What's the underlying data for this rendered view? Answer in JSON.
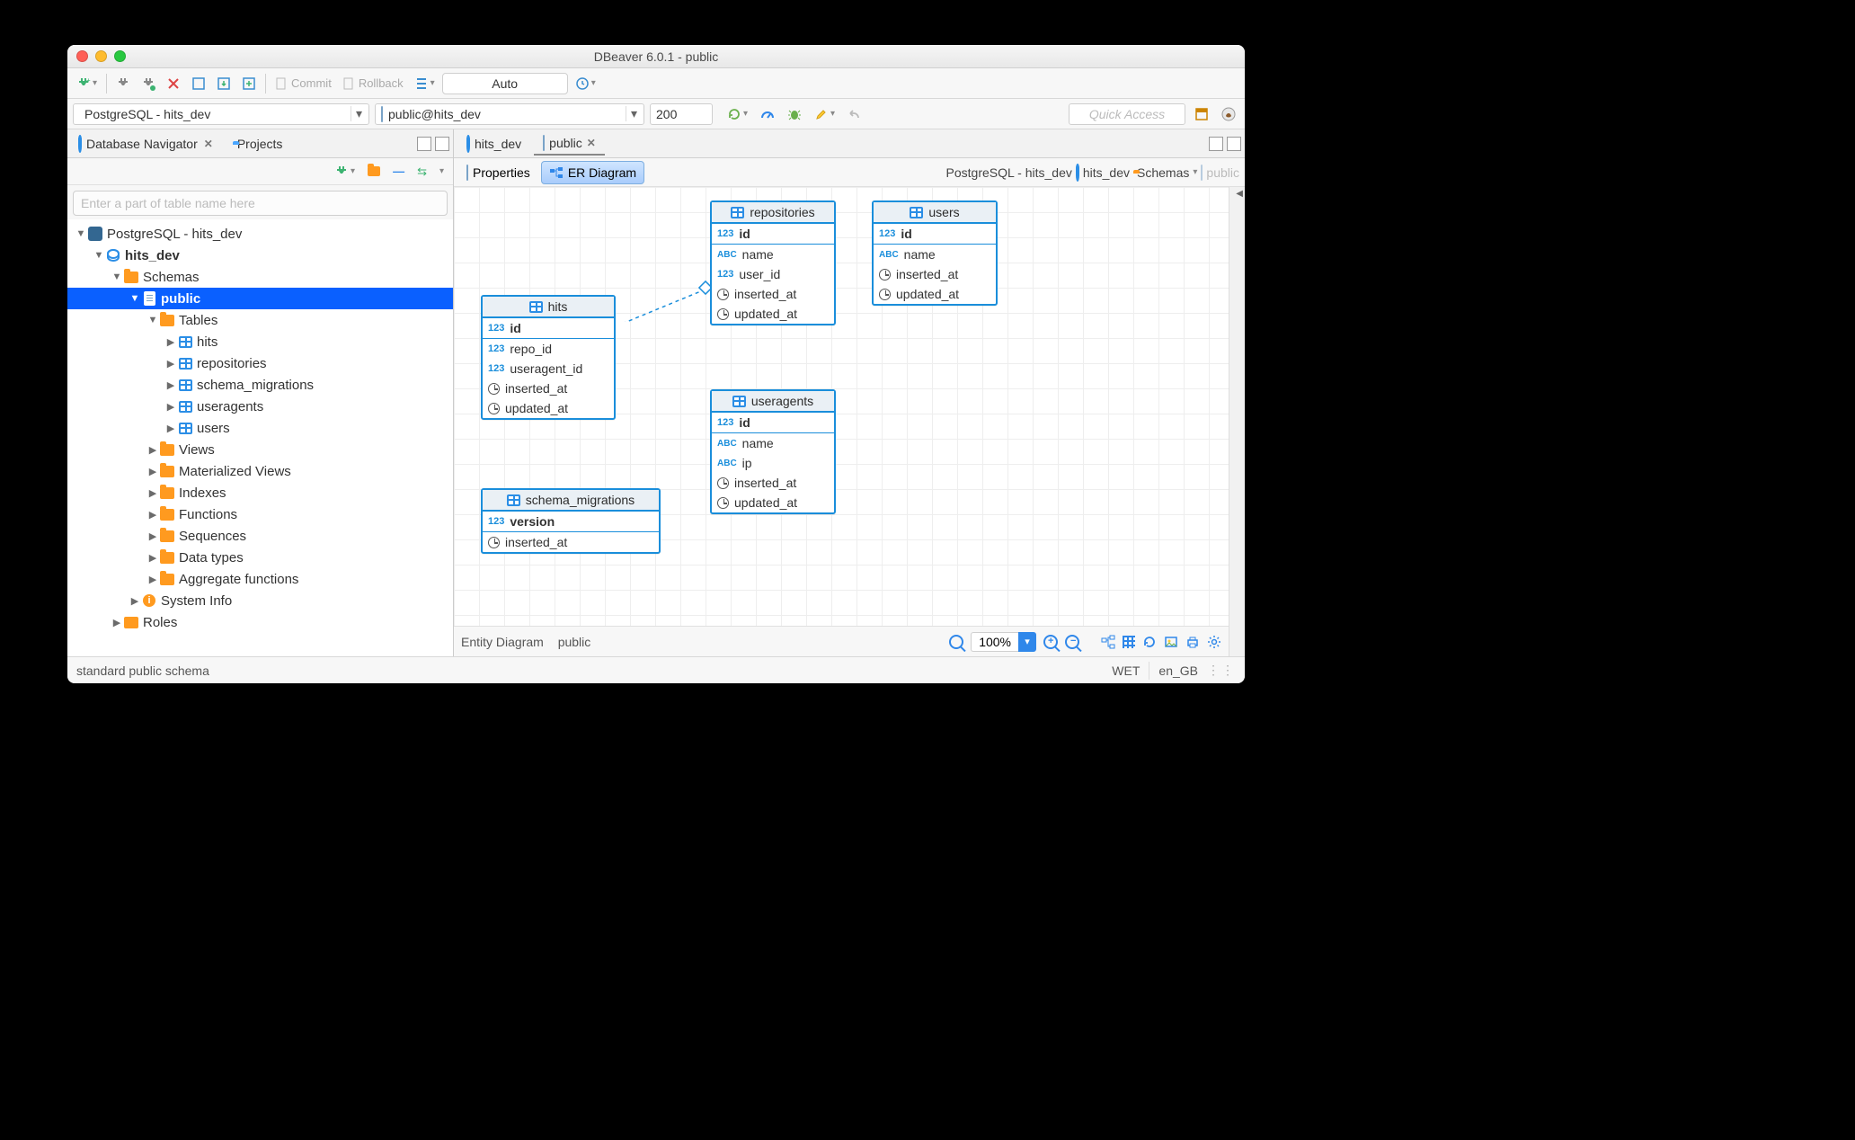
{
  "window": {
    "title": "DBeaver 6.0.1 - public"
  },
  "toolbar": {
    "commit": "Commit",
    "rollback": "Rollback",
    "mode": "Auto"
  },
  "connection_bar": {
    "connection": "PostgreSQL - hits_dev",
    "schema": "public@hits_dev",
    "rows": "200",
    "quick_access": "Quick Access"
  },
  "navigator": {
    "tab1": "Database Navigator",
    "tab2": "Projects",
    "filter_placeholder": "Enter a part of table name here",
    "tree": {
      "conn": "PostgreSQL - hits_dev",
      "db": "hits_dev",
      "schemas": "Schemas",
      "public": "public",
      "tables": "Tables",
      "t0": "hits",
      "t1": "repositories",
      "t2": "schema_migrations",
      "t3": "useragents",
      "t4": "users",
      "views": "Views",
      "mviews": "Materialized Views",
      "indexes": "Indexes",
      "functions": "Functions",
      "sequences": "Sequences",
      "datatypes": "Data types",
      "aggfns": "Aggregate functions",
      "sysinfo": "System Info",
      "roles": "Roles"
    }
  },
  "editor": {
    "tab_hitsdev": "hits_dev",
    "tab_public": "public",
    "subtab_properties": "Properties",
    "subtab_er": "ER Diagram",
    "crumb_conn": "PostgreSQL - hits_dev",
    "crumb_db": "hits_dev",
    "crumb_schemas": "Schemas",
    "crumb_public": "public"
  },
  "diagram": {
    "hits": {
      "name": "hits",
      "cols": [
        "id",
        "repo_id",
        "useragent_id",
        "inserted_at",
        "updated_at"
      ]
    },
    "repositories": {
      "name": "repositories",
      "cols": [
        "id",
        "name",
        "user_id",
        "inserted_at",
        "updated_at"
      ]
    },
    "users": {
      "name": "users",
      "cols": [
        "id",
        "name",
        "inserted_at",
        "updated_at"
      ]
    },
    "useragents": {
      "name": "useragents",
      "cols": [
        "id",
        "name",
        "ip",
        "inserted_at",
        "updated_at"
      ]
    },
    "schema_migrations": {
      "name": "schema_migrations",
      "cols": [
        "version",
        "inserted_at"
      ]
    }
  },
  "zoom": {
    "label1": "Entity Diagram",
    "label2": "public",
    "value": "100%"
  },
  "status": {
    "desc": "standard public schema",
    "tz": "WET",
    "locale": "en_GB"
  }
}
